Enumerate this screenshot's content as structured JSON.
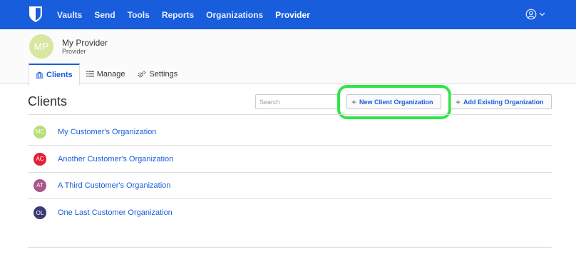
{
  "nav": {
    "logo_icon": "bitwarden-shield-icon",
    "items": [
      {
        "label": "Vaults"
      },
      {
        "label": "Send"
      },
      {
        "label": "Tools"
      },
      {
        "label": "Reports"
      },
      {
        "label": "Organizations"
      },
      {
        "label": "Provider",
        "active": true
      }
    ],
    "account_icon": "user-circle-icon",
    "account_menu_icon": "caret-down-icon",
    "color": "#175ddc"
  },
  "provider": {
    "initials": "MP",
    "name": "My Provider",
    "subtitle": "Provider",
    "avatar_color": "#d7e6a0"
  },
  "tabs": [
    {
      "label": "Clients",
      "icon": "bank-icon",
      "active": true
    },
    {
      "label": "Manage",
      "icon": "list-icon"
    },
    {
      "label": "Settings",
      "icon": "cogs-icon"
    }
  ],
  "main": {
    "title": "Clients",
    "search_placeholder": "Search",
    "new_client_button": "New Client Organization",
    "add_existing_button": "Add Existing Organization",
    "highlight_color": "#2fe547"
  },
  "clients": [
    {
      "initials": "MC",
      "name": "My Customer's Organization",
      "color": "#b8de76"
    },
    {
      "initials": "AC",
      "name": "Another Customer's Organization",
      "color": "#e51f36"
    },
    {
      "initials": "AT",
      "name": "A Third Customer's Organization",
      "color": "#a9578d"
    },
    {
      "initials": "OL",
      "name": "One Last Customer Organization",
      "color": "#3d3a76"
    }
  ]
}
